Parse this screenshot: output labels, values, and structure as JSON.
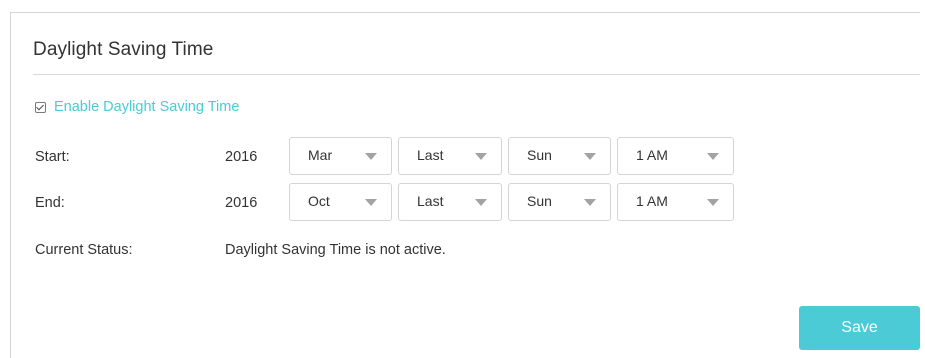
{
  "section": {
    "title": "Daylight Saving Time"
  },
  "enable": {
    "label": "Enable Daylight Saving Time",
    "checked": true
  },
  "start": {
    "label": "Start:",
    "year": "2016",
    "month": "Mar",
    "week": "Last",
    "day": "Sun",
    "time": "1 AM"
  },
  "end": {
    "label": "End:",
    "year": "2016",
    "month": "Oct",
    "week": "Last",
    "day": "Sun",
    "time": "1 AM"
  },
  "status": {
    "label": "Current Status:",
    "value": "Daylight Saving Time is not active."
  },
  "actions": {
    "save_label": "Save"
  },
  "colors": {
    "accent": "#4acbd6",
    "text": "#333333",
    "border": "#d5d5d5",
    "caret": "#a3a3a3"
  },
  "icons": {
    "checkbox": "checkbox-checked-icon",
    "dropdown": "dropdown-arrow-icon"
  }
}
